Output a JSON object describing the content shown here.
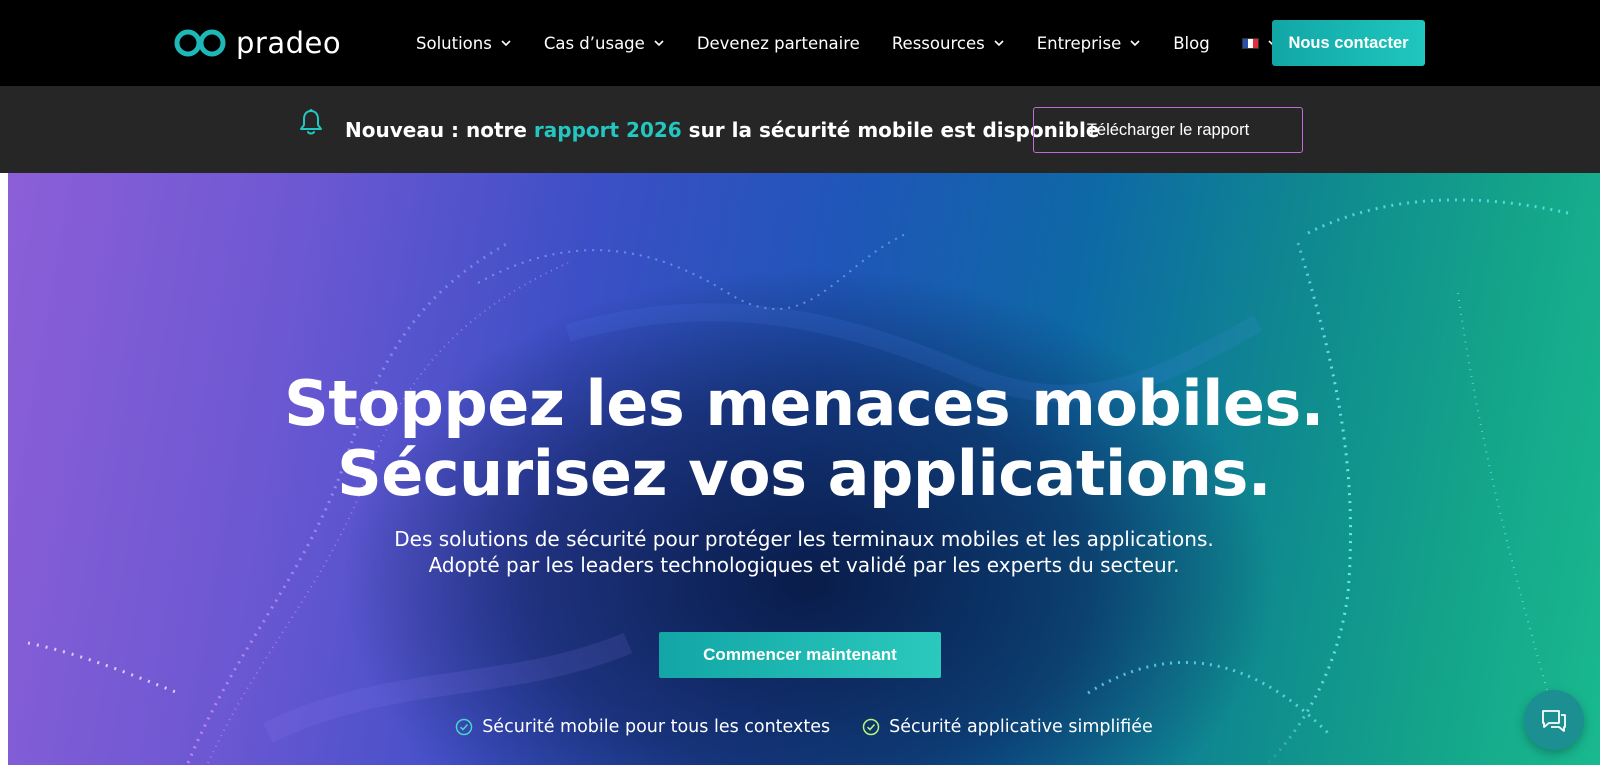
{
  "brand": {
    "name": "pradeo"
  },
  "nav": {
    "items": [
      {
        "label": "Solutions",
        "has_menu": true
      },
      {
        "label": "Cas d’usage",
        "has_menu": true
      },
      {
        "label": "Devenez partenaire",
        "has_menu": false
      },
      {
        "label": "Ressources",
        "has_menu": true
      },
      {
        "label": "Entreprise",
        "has_menu": true
      },
      {
        "label": "Blog",
        "has_menu": false
      }
    ],
    "language": {
      "icon": "french-flag-icon",
      "has_menu": true
    },
    "contact_label": "Nous contacter"
  },
  "announcement": {
    "text_before": "Nouveau : notre ",
    "highlight": "rapport 2026",
    "text_after": " sur la sécurité mobile est disponible",
    "button_label": "Télécharger le rapport",
    "icon": "bell-icon"
  },
  "hero": {
    "title_line1": "Stoppez les menaces mobiles.",
    "title_line2": "Sécurisez vos applications.",
    "subtitle_line1": "Des solutions de sécurité pour protéger les terminaux mobiles et les applications.",
    "subtitle_line2": "Adopté par les leaders technologiques et validé par les experts du secteur.",
    "cta_label": "Commencer maintenant",
    "features": [
      {
        "label": "Sécurité mobile pour tous les contextes",
        "icon": "check-circle-icon"
      },
      {
        "label": "Sécurité applicative simplifiée",
        "icon": "check-circle-icon"
      }
    ]
  },
  "chat": {
    "icon": "chat-icon"
  },
  "colors": {
    "accent": "#1fc7be",
    "nav_bg": "#000000",
    "announce_bg": "#262626",
    "hero_left": "#8c5fd8",
    "hero_right": "#19b98f"
  }
}
